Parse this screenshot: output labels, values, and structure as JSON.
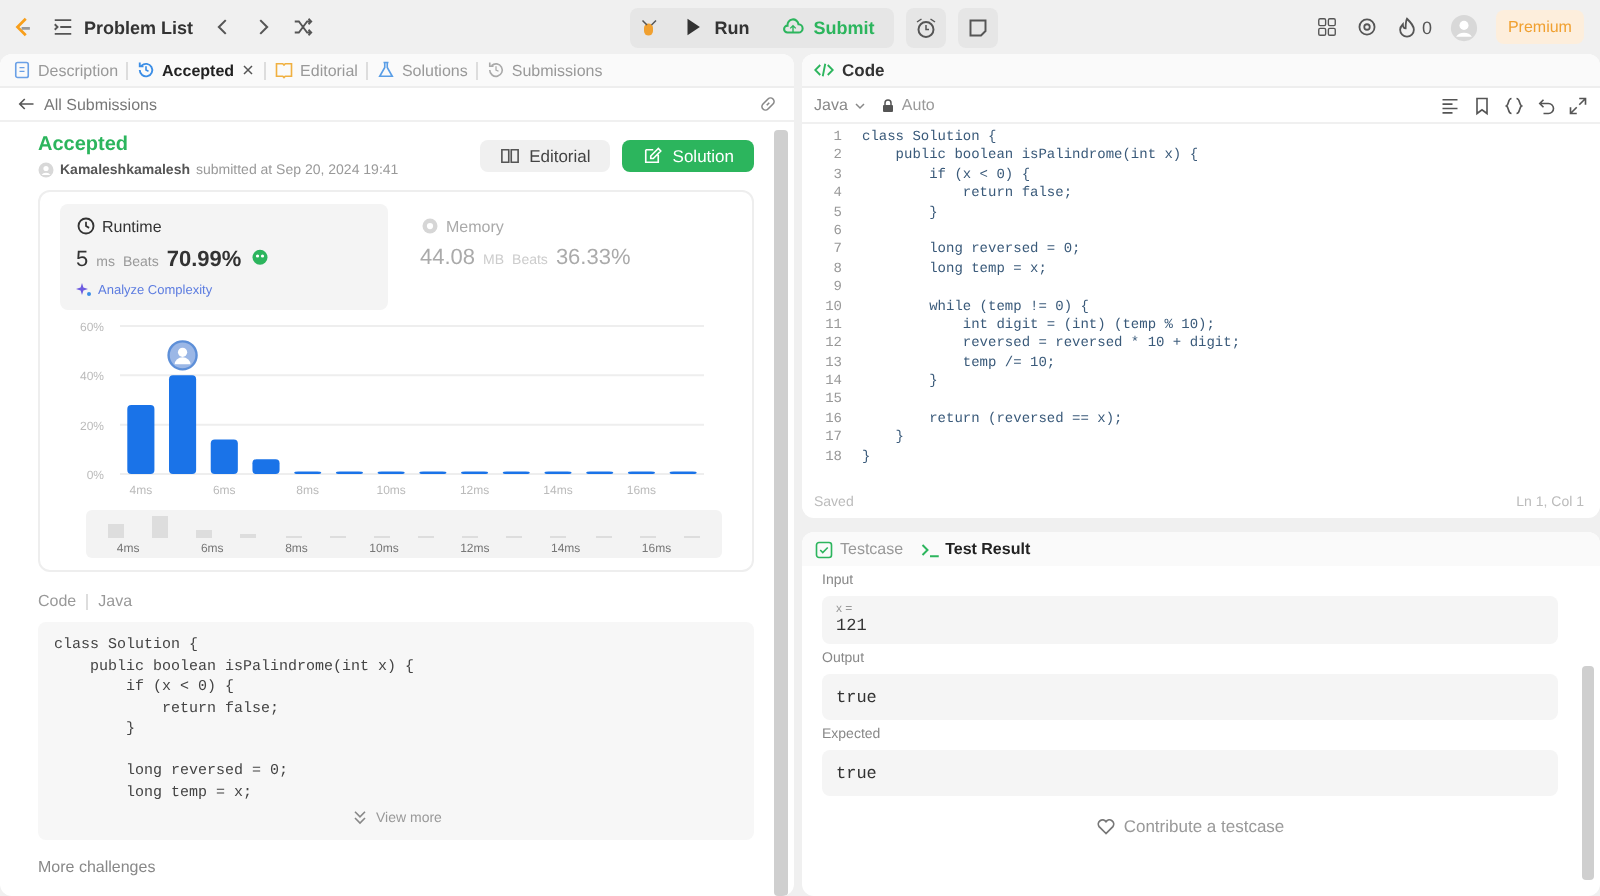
{
  "top_bar": {
    "title": "Problem List",
    "run": "Run",
    "submit": "Submit",
    "streak": "0",
    "premium": "Premium"
  },
  "left_tabs": [
    {
      "label": "Description",
      "selected": false,
      "closable": false
    },
    {
      "label": "Accepted",
      "selected": true,
      "closable": true
    },
    {
      "label": "Editorial",
      "selected": false,
      "closable": false
    },
    {
      "label": "Solutions",
      "selected": false,
      "closable": false
    },
    {
      "label": "Submissions",
      "selected": false,
      "closable": false
    }
  ],
  "back_link": "All Submissions",
  "submission": {
    "status": "Accepted",
    "user": "Kamaleshkamalesh",
    "submitted": "submitted at Sep 20, 2024 19:41",
    "editorial_button": "Editorial",
    "solution_button": "Solution"
  },
  "stats": [
    {
      "label": "Runtime",
      "value": "5",
      "unit": "ms",
      "beats_label": "Beats",
      "beats": "70.99%",
      "analyze": "Analyze Complexity",
      "selected": true
    },
    {
      "label": "Memory",
      "value": "44.08",
      "unit": "MB",
      "beats_label": "Beats",
      "beats": "36.33%",
      "selected": false
    }
  ],
  "chart_data": {
    "type": "bar",
    "x": [
      4,
      5,
      6,
      7,
      8,
      9,
      10,
      11,
      12,
      13,
      14,
      15,
      16,
      17
    ],
    "values": [
      28,
      40,
      14,
      6,
      1,
      1,
      1,
      1,
      1,
      1,
      1,
      1,
      1,
      1
    ],
    "xlim": [
      3.5,
      17.5
    ],
    "ylim": [
      0,
      60
    ],
    "xticks": [
      {
        "value": 4,
        "label": "4ms"
      },
      {
        "value": 6,
        "label": "6ms"
      },
      {
        "value": 8,
        "label": "8ms"
      },
      {
        "value": 10,
        "label": "10ms"
      },
      {
        "value": 12,
        "label": "12ms"
      },
      {
        "value": 14,
        "label": "14ms"
      },
      {
        "value": 16,
        "label": "16ms"
      }
    ],
    "yticks": [
      {
        "value": 0,
        "label": "0%"
      },
      {
        "value": 20,
        "label": "20%"
      },
      {
        "value": 40,
        "label": "40%"
      },
      {
        "value": 60,
        "label": "60%"
      }
    ]
  },
  "overview_labels": [
    "4ms",
    "6ms",
    "8ms",
    "10ms",
    "12ms",
    "14ms",
    "16ms"
  ],
  "submitted_code": {
    "label": "Code",
    "language": "Java",
    "view_more": "View more",
    "lines": [
      {
        "kind": "code",
        "text": "class Solution {"
      },
      {
        "kind": "code",
        "text": "    public boolean isPalindrome(int x) {"
      },
      {
        "kind": "code",
        "text": "        if (x < 0) {"
      },
      {
        "kind": "code",
        "text": "            return false;"
      },
      {
        "kind": "code",
        "text": "        }"
      },
      {
        "kind": "blank"
      },
      {
        "kind": "code",
        "text": "        long reversed = 0;"
      },
      {
        "kind": "code",
        "text": "        long temp = x;"
      }
    ]
  },
  "more_challenges": "More challenges",
  "editor": {
    "title": "Code",
    "language": "Java",
    "mode": "Auto",
    "status": "Saved",
    "cursor": "Ln 1, Col 1",
    "lines": [
      {
        "number": "1",
        "text": "class Solution {"
      },
      {
        "number": "2",
        "text": "    public boolean isPalindrome(int x) {"
      },
      {
        "number": "3",
        "text": "        if (x < 0) {"
      },
      {
        "number": "4",
        "text": "            return false;"
      },
      {
        "number": "5",
        "text": "        }"
      },
      {
        "number": "6"
      },
      {
        "number": "7",
        "text": "        long reversed = 0;"
      },
      {
        "number": "8",
        "text": "        long temp = x;"
      },
      {
        "number": "9"
      },
      {
        "number": "10",
        "text": "        while (temp != 0) {"
      },
      {
        "number": "11",
        "text": "            int digit = (int) (temp % 10);"
      },
      {
        "number": "12",
        "text": "            reversed = reversed * 10 + digit;"
      },
      {
        "number": "13",
        "text": "            temp /= 10;"
      },
      {
        "number": "14",
        "text": "        }"
      },
      {
        "number": "15"
      },
      {
        "number": "16",
        "text": "        return (reversed == x);"
      },
      {
        "number": "17",
        "text": "    }"
      },
      {
        "number": "18",
        "text": "}"
      }
    ]
  },
  "result_tabs": [
    {
      "label": "Testcase",
      "selected": false
    },
    {
      "label": "Test Result",
      "selected": true
    }
  ],
  "result": {
    "input_label": "Input",
    "variable": "x =",
    "input": "121",
    "output_label": "Output",
    "output": "true",
    "expected_label": "Expected",
    "expected": "true",
    "contribute": "Contribute a testcase"
  }
}
